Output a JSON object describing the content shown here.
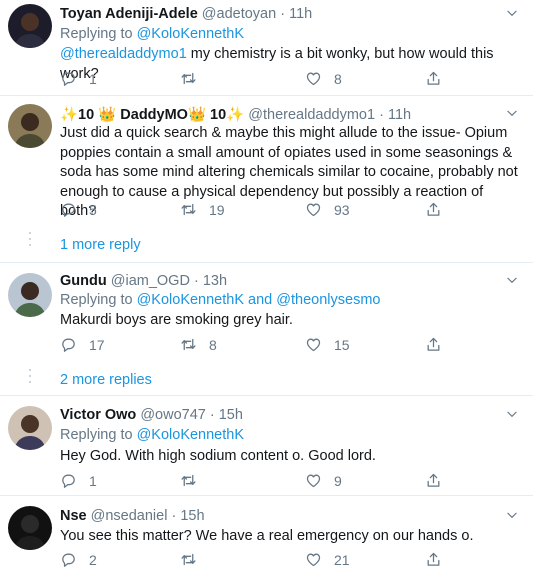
{
  "tweets": [
    {
      "name": "Toyan Adeniji-Adele",
      "handle": "@adetoyan",
      "time": "11h",
      "replying_prefix": "Replying to",
      "replying_to": "@KoloKennethK",
      "mention": "@therealdaddymo1",
      "text": " my chemistry is a bit wonky, but how would this work?",
      "replies": "1",
      "retweets": "",
      "likes": "8",
      "avatar_color": "#1c1c2a"
    },
    {
      "name_prefix": "✨10 👑 DaddyMO👑 10✨",
      "handle": "@therealdaddymo1",
      "time": "11h",
      "text": "Just did a quick search & maybe this might allude to the issue- Opium poppies contain a small amount of opiates used in some seasonings & soda has some mind altering chemicals similar to cocaine, probably not enough to cause a physical dependency but possibly a reaction of both?",
      "replies": "5",
      "retweets": "19",
      "likes": "93",
      "avatar_color": "#6b5b3a"
    },
    {
      "name": "Gundu",
      "handle": "@iam_OGD",
      "time": "13h",
      "replying_prefix": "Replying to",
      "replying_to": "@KoloKennethK",
      "replying_and": "and",
      "replying_to2": "@theonlysesmo",
      "text": "Makurdi boys are smoking grey hair.",
      "replies": "17",
      "retweets": "8",
      "likes": "15",
      "avatar_color": "#a8b8c8"
    },
    {
      "name": "Victor Owo",
      "handle": "@owo747",
      "time": "15h",
      "replying_prefix": "Replying to",
      "replying_to": "@KoloKennethK",
      "text": "Hey God. With high sodium content o. Good lord.",
      "replies": "1",
      "retweets": "",
      "likes": "9",
      "avatar_color": "#5a4a40"
    },
    {
      "name": "Nse",
      "handle": "@nsedaniel",
      "time": "15h",
      "text": "You see this matter? We have a real emergency on our hands o.",
      "replies": "2",
      "retweets": "",
      "likes": "21",
      "avatar_color": "#111111"
    }
  ],
  "more_replies": [
    "1 more reply",
    "2 more replies"
  ],
  "dot": "·",
  "icons": [
    "reply-icon",
    "retweet-icon",
    "like-icon",
    "share-icon",
    "chevron-down-icon"
  ],
  "colors": {
    "link": "#1b95e0",
    "muted": "#657786",
    "divider": "#e6ecf0"
  }
}
